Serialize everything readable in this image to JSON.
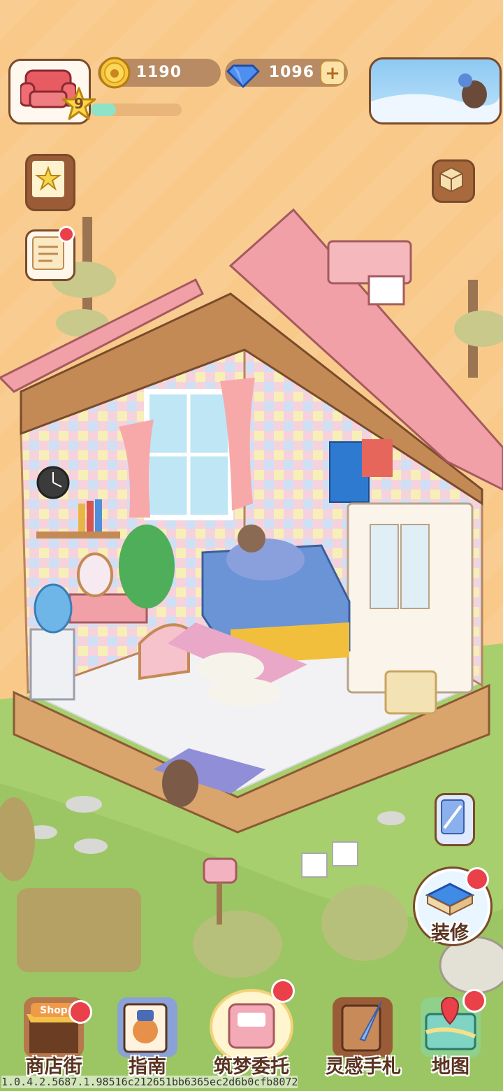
{
  "hud": {
    "level": "9",
    "xp_progress": 0.28,
    "coins": "1190",
    "gems": "1096",
    "add_gems_symbol": "+"
  },
  "nav": {
    "shop_street": "商店街",
    "guide": "指南",
    "dream_commission": "筑梦委托",
    "inspiration_notebook": "灵感手札",
    "map": "地图",
    "shop_sign": "Shop"
  },
  "decorate_label": "装修",
  "version": "1.0.4.2.5687.1.98516c212651bb6365ec2d6b0cfb8072",
  "colors": {
    "roof": "#f0a0a6",
    "wood": "#c48a55",
    "grass": "#a7cf6e",
    "background": "#f9c98a",
    "badge": "#e9404a"
  }
}
